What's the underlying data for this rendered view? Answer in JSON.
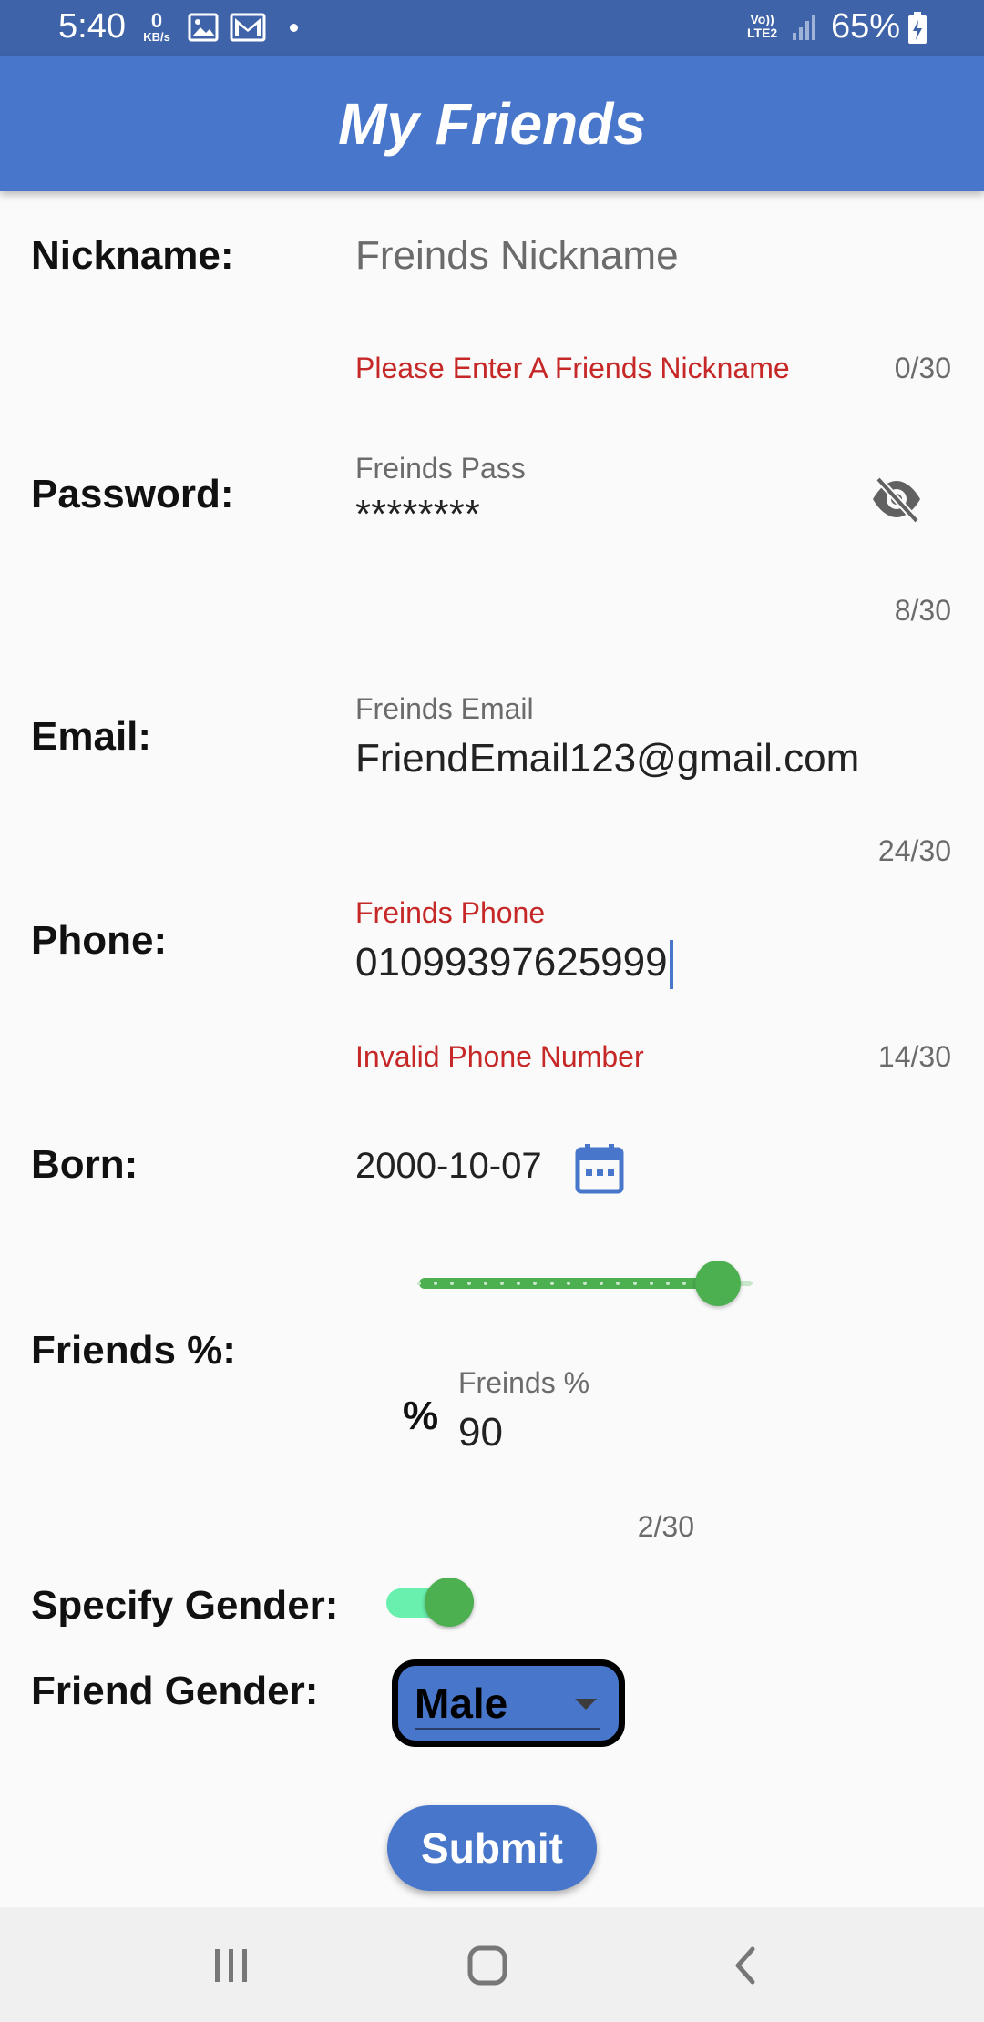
{
  "status_bar": {
    "time": "5:40",
    "net_speed_value": "0",
    "net_speed_unit": "KB/s",
    "volte_line1": "Vo))",
    "volte_line2": "LTE2",
    "battery_percent": "65%"
  },
  "app_bar": {
    "title": "My Friends"
  },
  "form": {
    "nickname": {
      "label": "Nickname:",
      "placeholder": "Freinds Nickname",
      "error": "Please Enter A Friends Nickname",
      "counter": "0/30"
    },
    "password": {
      "label": "Password:",
      "field_label": "Freinds Pass",
      "value": "********",
      "counter": "8/30"
    },
    "email": {
      "label": "Email:",
      "field_label": "Freinds Email",
      "value": "FriendEmail123@gmail.com",
      "counter": "24/30"
    },
    "phone": {
      "label": "Phone:",
      "field_label": "Freinds Phone",
      "value": "01099397625999",
      "error": "Invalid Phone Number",
      "counter": "14/30"
    },
    "born": {
      "label": "Born:",
      "value": "2000-10-07"
    },
    "friends_percent": {
      "label": "Friends %:",
      "slider_value_fraction": 0.9,
      "prefix": "%",
      "field_label": "Freinds %",
      "value": "90",
      "counter": "2/30"
    },
    "specify_gender": {
      "label": "Specify Gender:",
      "on": true
    },
    "friend_gender": {
      "label": "Friend Gender:",
      "selected": "Male"
    },
    "submit_label": "Submit"
  },
  "colors": {
    "status_bar": "#3f63a8",
    "app_bar": "#4876cb",
    "error": "#c62828",
    "slider": "#4caf50",
    "toggle_track": "#69f0ae"
  },
  "icons": {
    "password_toggle": "visibility-off-icon",
    "date_picker": "calendar-icon",
    "dropdown": "arrow-drop-down-icon",
    "nav_recents": "recents-icon",
    "nav_home": "home-icon",
    "nav_back": "back-icon"
  }
}
